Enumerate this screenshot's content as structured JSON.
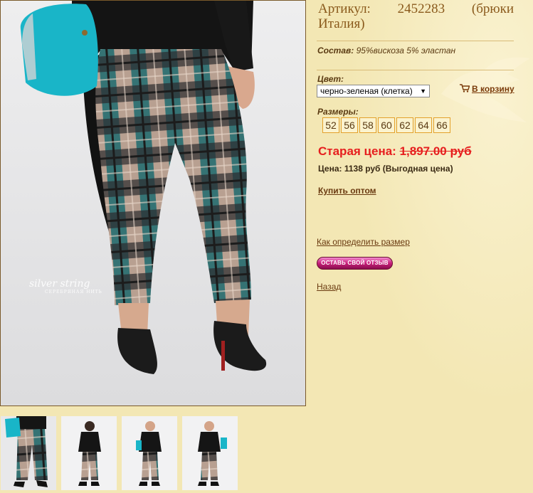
{
  "product": {
    "title_line1_left": "Артикул:",
    "title_line1_mid": "2452283",
    "title_line1_right": "(брюки",
    "title_line2": "Италия)",
    "composition_label": "Состав:",
    "composition_value": "95%вискоза 5% эластан"
  },
  "color": {
    "label": "Цвет:",
    "selected": "черно-зеленая (клетка)"
  },
  "cart": {
    "label": "В корзину",
    "icon": "cart-icon"
  },
  "sizes": {
    "label": "Размеры:",
    "values": [
      "52",
      "56",
      "58",
      "60",
      "62",
      "64",
      "66"
    ]
  },
  "pricing": {
    "old_label": "Старая цена:",
    "old_value": "1,897.00 руб",
    "current": "Цена: 1138 руб (Выгодная цена)"
  },
  "links": {
    "wholesale": "Купить оптом",
    "size_help": "Как определить размер",
    "review_button": "ОСТАВЬ СВОЙ ОТЗЫВ",
    "back": "Назад"
  },
  "photo": {
    "watermark": "silver string",
    "watermark_sub": "СЕРЕБРЯНАЯ НИТЬ"
  },
  "colors": {
    "background": "#f3e7b4",
    "text_brown": "#5a3a12",
    "old_price_red": "#e61e1e",
    "size_border": "#e3a12b",
    "plaid_teal": "#1f6b6f",
    "plaid_tan": "#b8a091",
    "bag_turquoise": "#19b5c8"
  }
}
